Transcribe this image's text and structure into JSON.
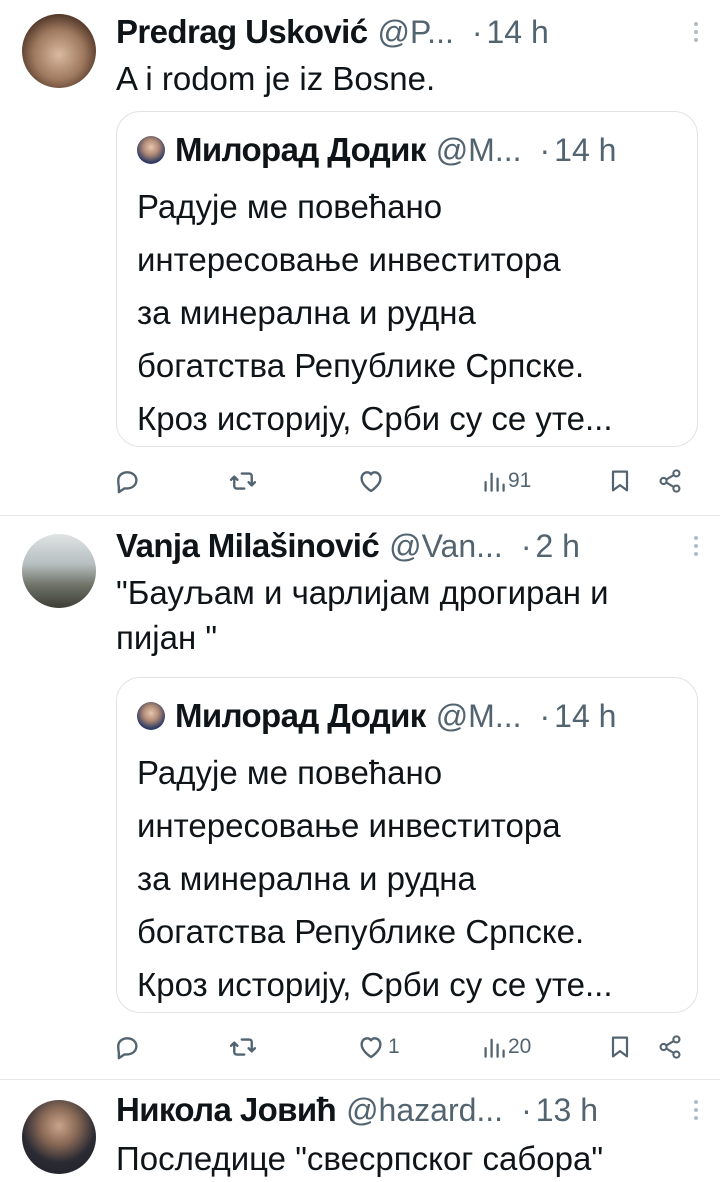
{
  "tweets": [
    {
      "name": "Predrag Usković",
      "handle": "@P...",
      "time": "14 h",
      "text": "A i rodom je iz Bosne.",
      "quote": {
        "name": "Милорад Додик",
        "handle": "@M...",
        "time": "14 h",
        "text_lines": [
          "Радује ме повећано",
          "интересовање инвеститора",
          "за минерална и рудна",
          "богатства Републике Српске.",
          "Кроз историју, Срби су се уте..."
        ]
      },
      "stats": {
        "replies": "",
        "reposts": "",
        "likes": "",
        "views": "91"
      }
    },
    {
      "name": "Vanja Milašinović",
      "handle": "@Van...",
      "time": "2 h",
      "text_lines": [
        "\"Бауљам и чарлијам дрогиран и",
        "пијан \""
      ],
      "quote": {
        "name": "Милорад Додик",
        "handle": "@M...",
        "time": "14 h",
        "text_lines": [
          "Радује ме повећано",
          "интересовање инвеститора",
          "за минерална и рудна",
          "богатства Републике Српске.",
          "Кроз историју, Срби су се уте..."
        ]
      },
      "stats": {
        "replies": "",
        "reposts": "",
        "likes": "1",
        "views": "20"
      }
    },
    {
      "name": "Никола Јовић",
      "handle": "@hazard...",
      "time": "13 h",
      "text": "Последице \"свесрпског сабора\""
    }
  ],
  "separator": "·",
  "icons": [
    "reply-icon",
    "repost-icon",
    "like-icon",
    "views-icon",
    "bookmark-icon",
    "share-icon",
    "more-icon"
  ]
}
